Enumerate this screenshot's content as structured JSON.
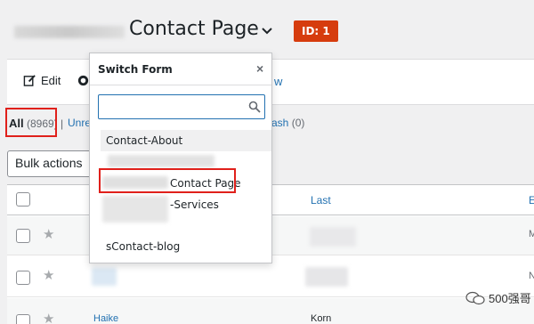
{
  "header": {
    "title": "Contact Page",
    "id_badge": "ID: 1"
  },
  "toolbar": {
    "edit_label": "Edit",
    "tail_text": "w"
  },
  "filters": {
    "all_label": "All",
    "all_count": "(8969)",
    "separator": "|",
    "unread_partial": "Unre",
    "trash_partial": "ash",
    "trash_count": "(0)"
  },
  "bulk_actions": {
    "label": "Bulk actions"
  },
  "table": {
    "headers": {
      "last": "Last",
      "tail": "E"
    },
    "rows": [
      {
        "tail": "M"
      },
      {
        "tail": "N"
      },
      {
        "name": "Haike",
        "last": "Korn",
        "tail": ""
      }
    ]
  },
  "dropdown": {
    "title": "Switch Form",
    "close": "×",
    "search_value": "",
    "items": [
      {
        "label": "Contact-About",
        "selected": true
      },
      {
        "label": "",
        "blurred": true
      },
      {
        "label": "Contact Page",
        "partial_blur": true
      },
      {
        "label": "-Services",
        "partial_blur": true
      },
      {
        "label": "sContact-blog"
      }
    ]
  },
  "watermark": {
    "text": "500强哥"
  },
  "colors": {
    "accent": "#2271b1",
    "badge": "#d63c0e",
    "highlight_border": "#e0201b"
  }
}
